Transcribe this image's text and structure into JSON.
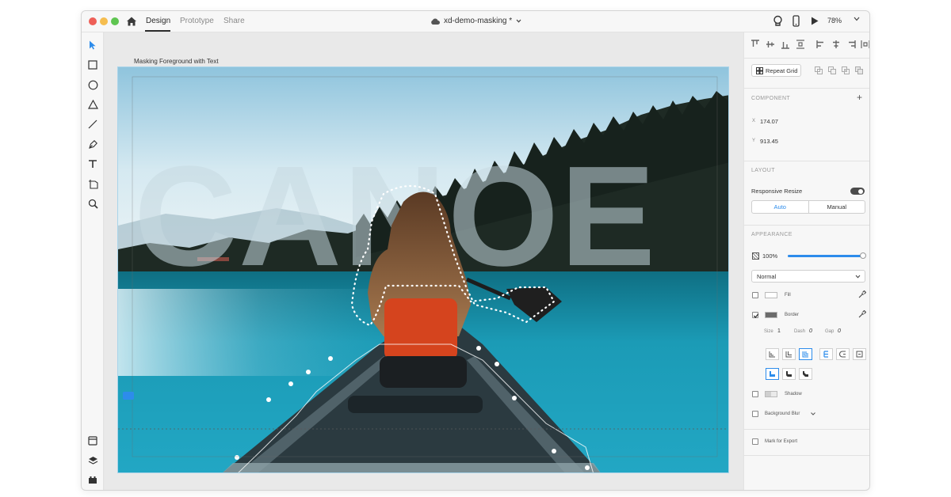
{
  "titlebar": {
    "tabs": [
      "Design",
      "Prototype",
      "Share"
    ],
    "document_title": "xd-demo-masking *",
    "zoom": "78%"
  },
  "toolbar": {
    "tools": [
      "select-tool-icon",
      "rectangle-tool-icon",
      "ellipse-tool-icon",
      "polygon-tool-icon",
      "line-tool-icon",
      "pen-tool-icon",
      "text-tool-icon",
      "artboard-tool-icon",
      "zoom-tool-icon"
    ],
    "bottom_tools": [
      "assets-panel-icon",
      "layers-panel-icon",
      "plugins-panel-icon"
    ]
  },
  "canvas": {
    "artboard_label": "Masking Foreground with Text",
    "headline": "CANOE"
  },
  "panel": {
    "repeat_grid": "Repeat Grid",
    "component_label": "COMPONENT",
    "x_label": "X",
    "x_value": "174.07",
    "y_label": "Y",
    "y_value": "913.45",
    "layout_label": "LAYOUT",
    "responsive_resize": "Responsive Resize",
    "resize_auto": "Auto",
    "resize_manual": "Manual",
    "appearance_label": "APPEARANCE",
    "opacity": "100%",
    "opacity_fraction": 1.0,
    "blend_mode": "Normal",
    "fill_label": "Fill",
    "border_label": "Border",
    "size_label": "Size",
    "size_value": "1",
    "dash_label": "Dash",
    "dash_value": "0",
    "gap_label": "Gap",
    "gap_value": "0",
    "shadow_label": "Shadow",
    "background_blur_label": "Background Blur",
    "mark_for_export": "Mark for Export",
    "accent_color": "#2d8ceb"
  }
}
